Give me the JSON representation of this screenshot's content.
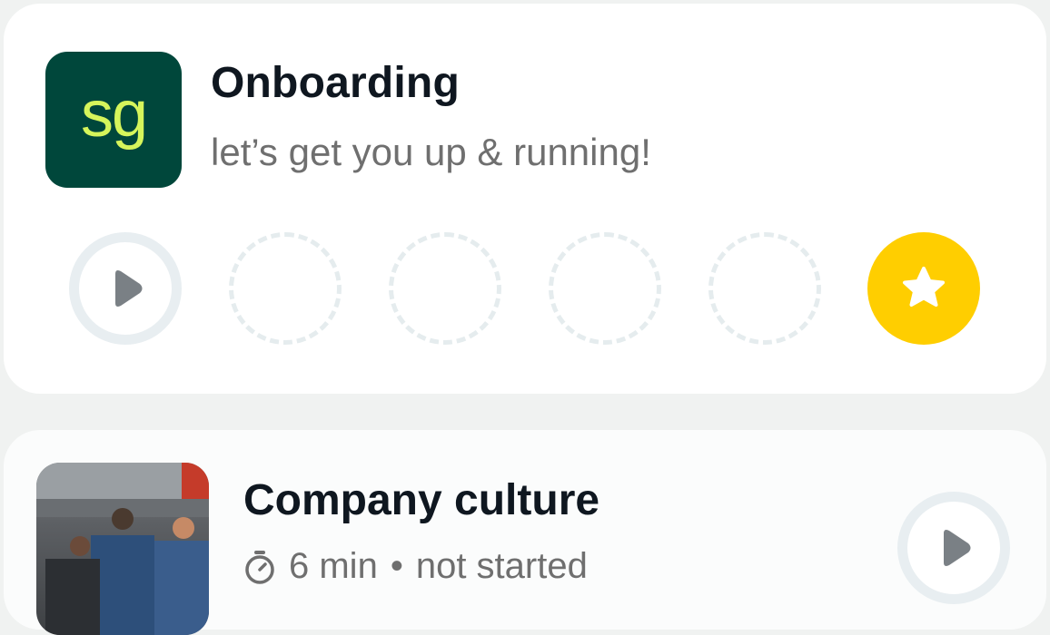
{
  "onboarding": {
    "logo_text": "sg",
    "title": "Onboarding",
    "subtitle": "let’s get you up & running!",
    "steps": [
      {
        "state": "play-icon"
      },
      {
        "state": "empty"
      },
      {
        "state": "empty"
      },
      {
        "state": "empty"
      },
      {
        "state": "empty"
      },
      {
        "state": "star-icon"
      }
    ]
  },
  "course": {
    "title": "Company culture",
    "duration": "6 min",
    "separator": "•",
    "status": "not started"
  },
  "colors": {
    "brand_green": "#00473b",
    "brand_lime": "#d6f55b",
    "star_yellow": "#ffce00",
    "ring_grey": "#e8eef1"
  }
}
